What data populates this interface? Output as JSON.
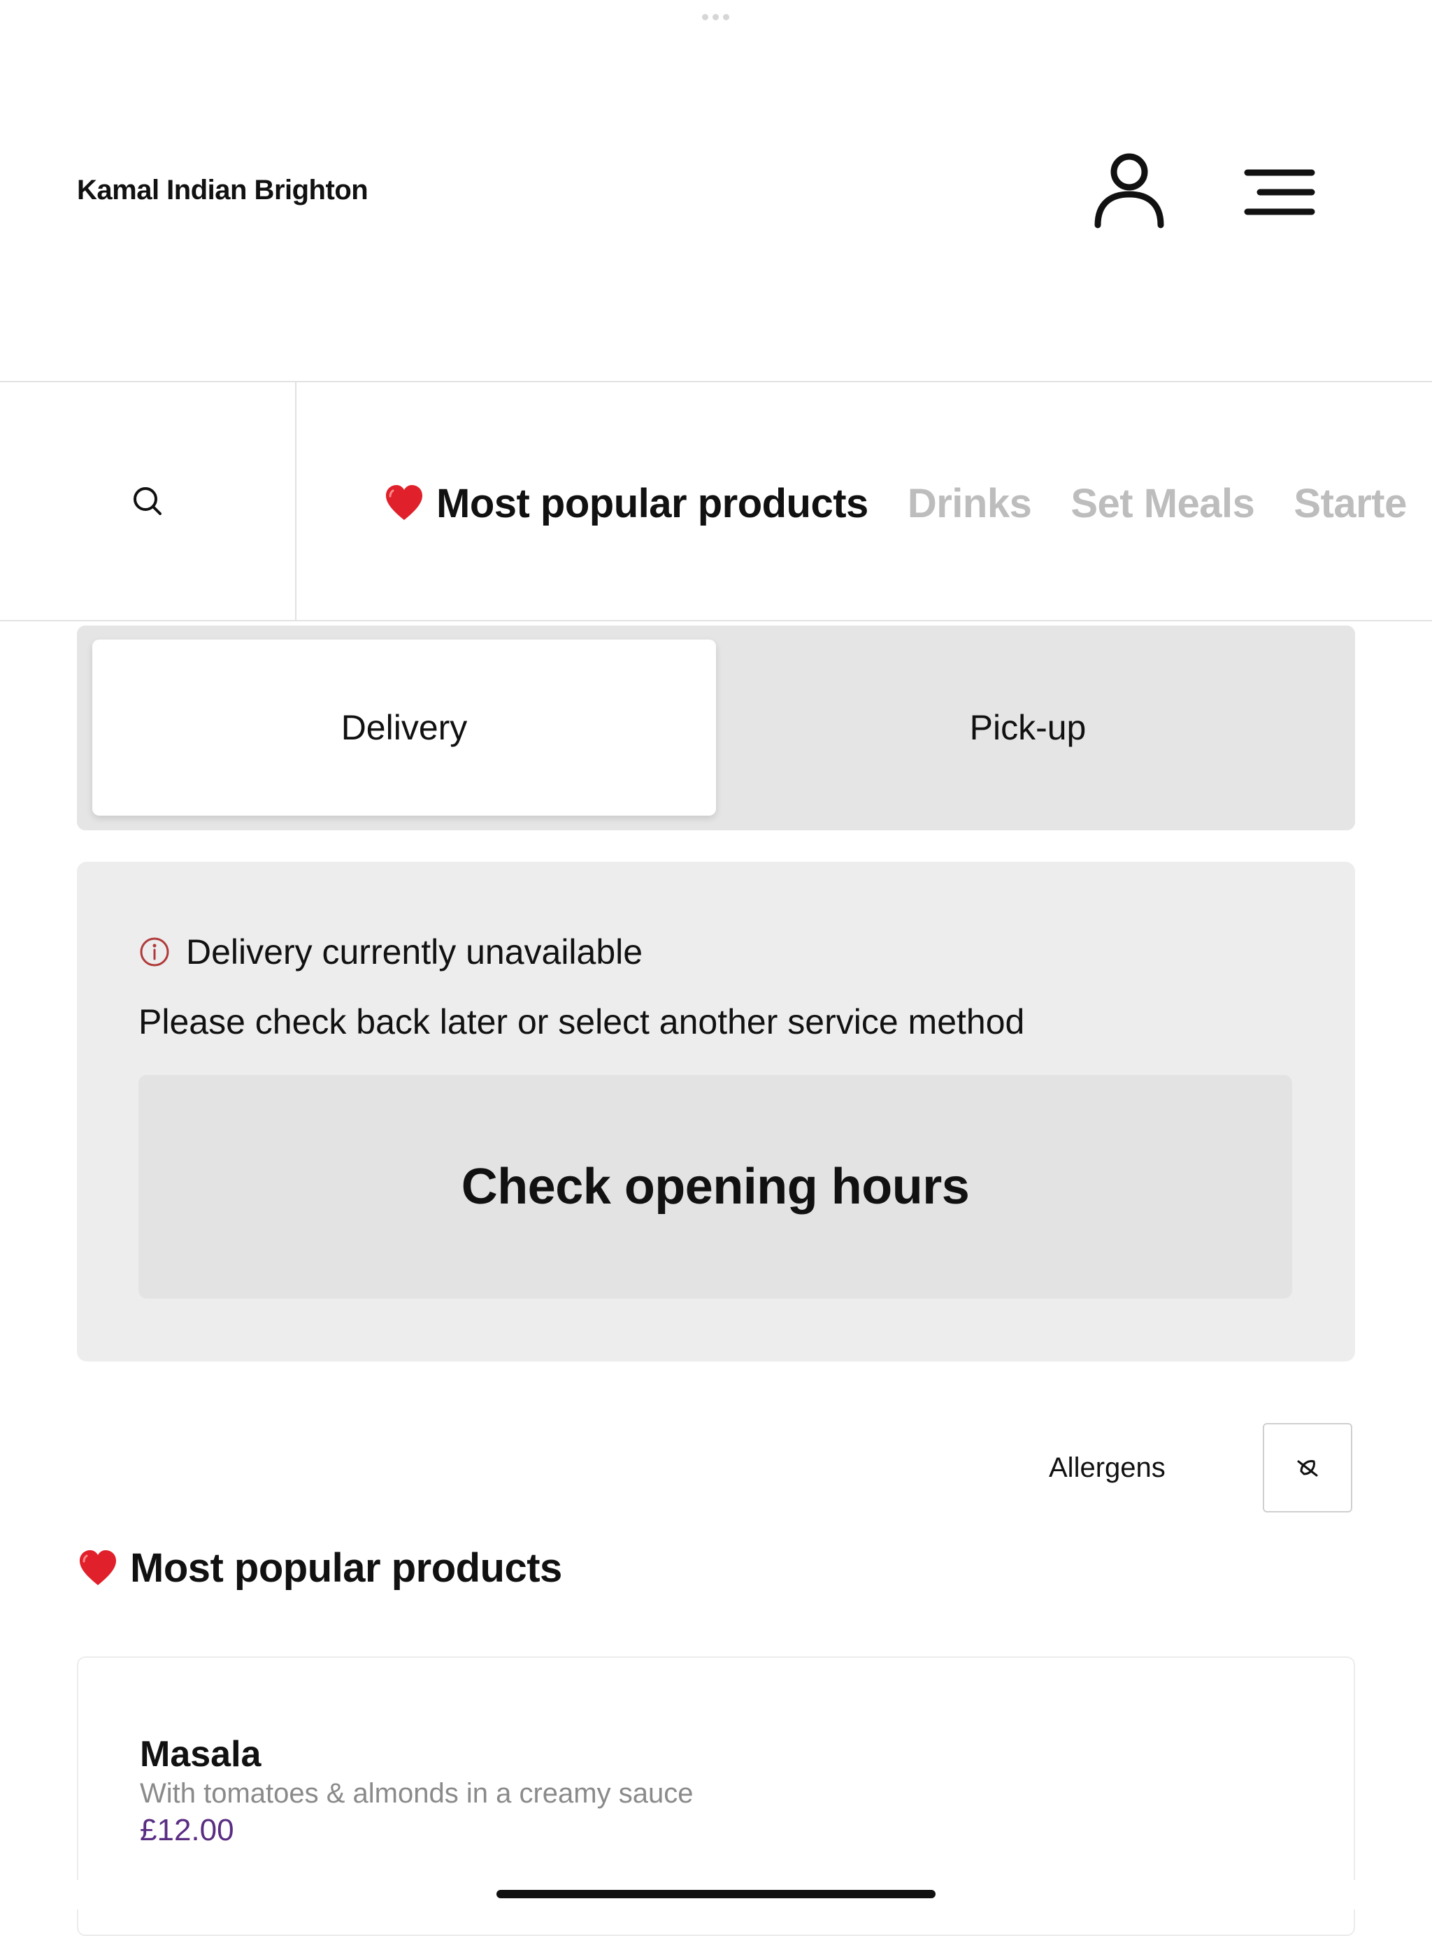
{
  "header": {
    "brand": "Kamal Indian Brighton",
    "account_icon": "user-icon",
    "menu_icon": "hamburger-menu-icon"
  },
  "categories": {
    "search_icon": "search-icon",
    "items": [
      {
        "label": "Most popular products",
        "icon": "heart-icon",
        "active": true
      },
      {
        "label": "Drinks",
        "active": false
      },
      {
        "label": "Set Meals",
        "active": false
      },
      {
        "label": "Starte",
        "active": false
      }
    ]
  },
  "service_toggle": {
    "delivery": "Delivery",
    "pickup": "Pick-up",
    "selected": "Delivery"
  },
  "notice": {
    "title": "Delivery currently unavailable",
    "message": "Please check back later or select another service method",
    "button": "Check opening hours",
    "icon": "info-icon"
  },
  "allergens": {
    "label": "Allergens",
    "icon": "allergen-filter-icon"
  },
  "section": {
    "title": "Most popular products",
    "icon": "heart-icon"
  },
  "products": [
    {
      "name": "Masala",
      "description": "With tomatoes & almonds in a creamy sauce",
      "price": "£12.00"
    }
  ],
  "colors": {
    "price": "#5a2d82",
    "inactive_category": "#bdbdbd",
    "info_icon": "#b03a3a",
    "heart": "#e0202a"
  }
}
